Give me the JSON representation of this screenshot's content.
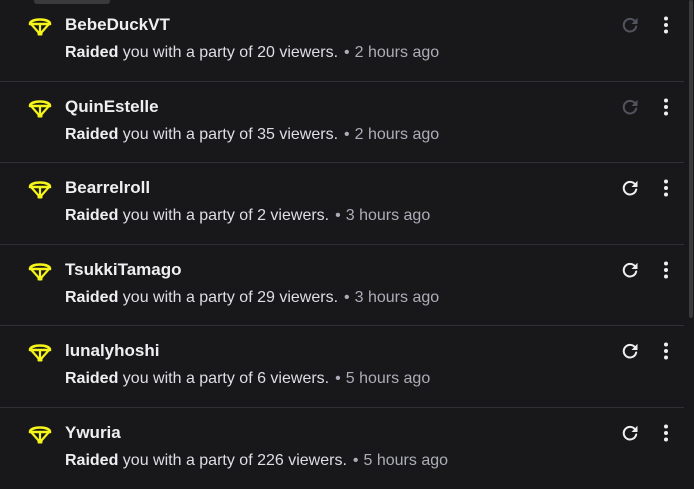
{
  "colors": {
    "raid_icon": "#f5f51a",
    "background": "#18181b",
    "divider": "#2f2f35",
    "muted": "#adadb8",
    "disabled_icon": "#53535f"
  },
  "raid_prefix": "Raided",
  "separator": "•",
  "icons": {
    "raid": "parachute-icon",
    "refresh": "refresh-icon",
    "more": "more-vertical-icon"
  },
  "raids": [
    {
      "name": "BebeDuckVT",
      "detail": "you with a party of 20 viewers.",
      "time": "2 hours ago",
      "refresh_enabled": false
    },
    {
      "name": "QuinEstelle",
      "detail": "you with a party of 35 viewers.",
      "time": "2 hours ago",
      "refresh_enabled": false
    },
    {
      "name": "Bearrelroll",
      "detail": "you with a party of 2 viewers.",
      "time": "3 hours ago",
      "refresh_enabled": true
    },
    {
      "name": "TsukkiTamago",
      "detail": "you with a party of 29 viewers.",
      "time": "3 hours ago",
      "refresh_enabled": true
    },
    {
      "name": "lunalyhoshi",
      "detail": "you with a party of 6 viewers.",
      "time": "5 hours ago",
      "refresh_enabled": true
    },
    {
      "name": "Ywuria",
      "detail": "you with a party of 226 viewers.",
      "time": "5 hours ago",
      "refresh_enabled": true
    }
  ]
}
